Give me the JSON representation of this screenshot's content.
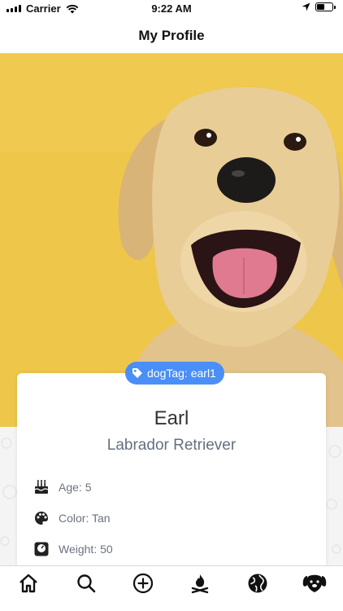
{
  "status_bar": {
    "carrier": "Carrier",
    "time": "9:22 AM",
    "icons": [
      "signal-icon",
      "wifi-icon",
      "location-arrow-icon",
      "battery-icon"
    ],
    "battery_level": 0.45
  },
  "nav": {
    "title": "My Profile"
  },
  "profile": {
    "tag_label": "dogTag: earl1",
    "name": "Earl",
    "breed": "Labrador Retriever",
    "details": [
      {
        "icon": "birthday-cake-icon",
        "label": "Age: 5"
      },
      {
        "icon": "palette-icon",
        "label": "Color: Tan"
      },
      {
        "icon": "weight-scale-icon",
        "label": "Weight: 50"
      }
    ]
  },
  "tab_bar": {
    "items": [
      "home-icon",
      "search-icon",
      "add-circle-icon",
      "campfire-icon",
      "globe-icon",
      "dog-face-icon"
    ]
  },
  "colors": {
    "accent": "#4a8ff7",
    "photo_background": "#eec64a",
    "dog_fur": "#e8c98f"
  }
}
